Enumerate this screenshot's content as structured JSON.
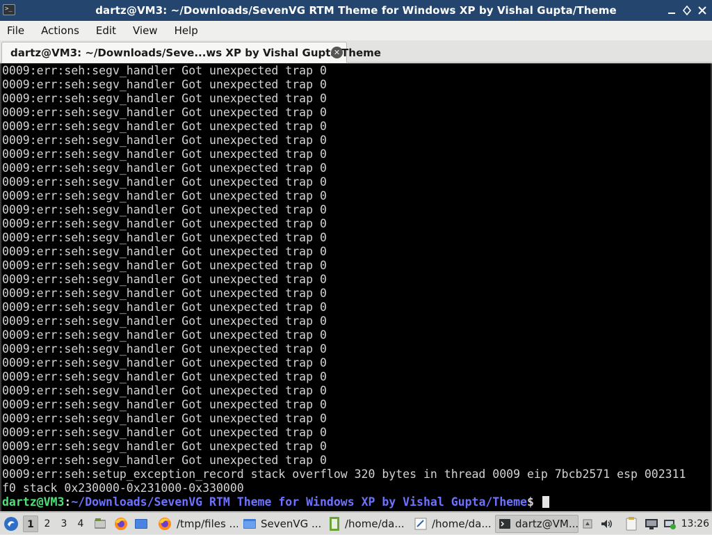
{
  "window": {
    "title": "dartz@VM3: ~/Downloads/SevenVG RTM Theme for Windows XP by Vishal Gupta/Theme",
    "buttons": {
      "minimize": "_",
      "maximize": "◇",
      "close": "✕"
    }
  },
  "menubar": {
    "items": [
      "File",
      "Actions",
      "Edit",
      "View",
      "Help"
    ]
  },
  "tab": {
    "label": "dartz@VM3: ~/Downloads/Seve...ws XP by Vishal Gupta/Theme",
    "close": "✕"
  },
  "terminal": {
    "lines": [
      "0009:err:seh:segv_handler Got unexpected trap 0",
      "0009:err:seh:segv_handler Got unexpected trap 0",
      "0009:err:seh:segv_handler Got unexpected trap 0",
      "0009:err:seh:segv_handler Got unexpected trap 0",
      "0009:err:seh:segv_handler Got unexpected trap 0",
      "0009:err:seh:segv_handler Got unexpected trap 0",
      "0009:err:seh:segv_handler Got unexpected trap 0",
      "0009:err:seh:segv_handler Got unexpected trap 0",
      "0009:err:seh:segv_handler Got unexpected trap 0",
      "0009:err:seh:segv_handler Got unexpected trap 0",
      "0009:err:seh:segv_handler Got unexpected trap 0",
      "0009:err:seh:segv_handler Got unexpected trap 0",
      "0009:err:seh:segv_handler Got unexpected trap 0",
      "0009:err:seh:segv_handler Got unexpected trap 0",
      "0009:err:seh:segv_handler Got unexpected trap 0",
      "0009:err:seh:segv_handler Got unexpected trap 0",
      "0009:err:seh:segv_handler Got unexpected trap 0",
      "0009:err:seh:segv_handler Got unexpected trap 0",
      "0009:err:seh:segv_handler Got unexpected trap 0",
      "0009:err:seh:segv_handler Got unexpected trap 0",
      "0009:err:seh:segv_handler Got unexpected trap 0",
      "0009:err:seh:segv_handler Got unexpected trap 0",
      "0009:err:seh:segv_handler Got unexpected trap 0",
      "0009:err:seh:segv_handler Got unexpected trap 0",
      "0009:err:seh:segv_handler Got unexpected trap 0",
      "0009:err:seh:segv_handler Got unexpected trap 0",
      "0009:err:seh:segv_handler Got unexpected trap 0",
      "0009:err:seh:segv_handler Got unexpected trap 0",
      "0009:err:seh:segv_handler Got unexpected trap 0",
      "0009:err:seh:setup_exception_record stack overflow 320 bytes in thread 0009 eip 7bcb2571 esp 002311",
      "f0 stack 0x230000-0x231000-0x330000"
    ],
    "prompt": {
      "user": "dartz@VM3",
      "separator": ":",
      "path": "~/Downloads/SevenVG RTM Theme for Windows XP by Vishal Gupta/Theme",
      "symbol": "$ "
    },
    "colors": {
      "background": "#000000",
      "text": "#d3d3d3",
      "prompt_user": "#4fe07a",
      "prompt_path": "#6d72ff"
    }
  },
  "taskbar": {
    "workspaces": [
      "1",
      "2",
      "3",
      "4"
    ],
    "active_workspace": "1",
    "tasks": [
      {
        "icon": "firefox-icon",
        "label": "/tmp/files ..."
      },
      {
        "icon": "folder-icon",
        "label": "SevenVG ..."
      },
      {
        "icon": "text-editor-icon",
        "label": "/home/da..."
      },
      {
        "icon": "document-icon",
        "label": "/home/da..."
      },
      {
        "icon": "terminal-icon",
        "label": "dartz@VM..."
      }
    ],
    "tray_icons": [
      "window-switch-icon",
      "volume-icon",
      "clipboard-icon",
      "display-icon",
      "network-icon"
    ],
    "clock": "13:26"
  }
}
